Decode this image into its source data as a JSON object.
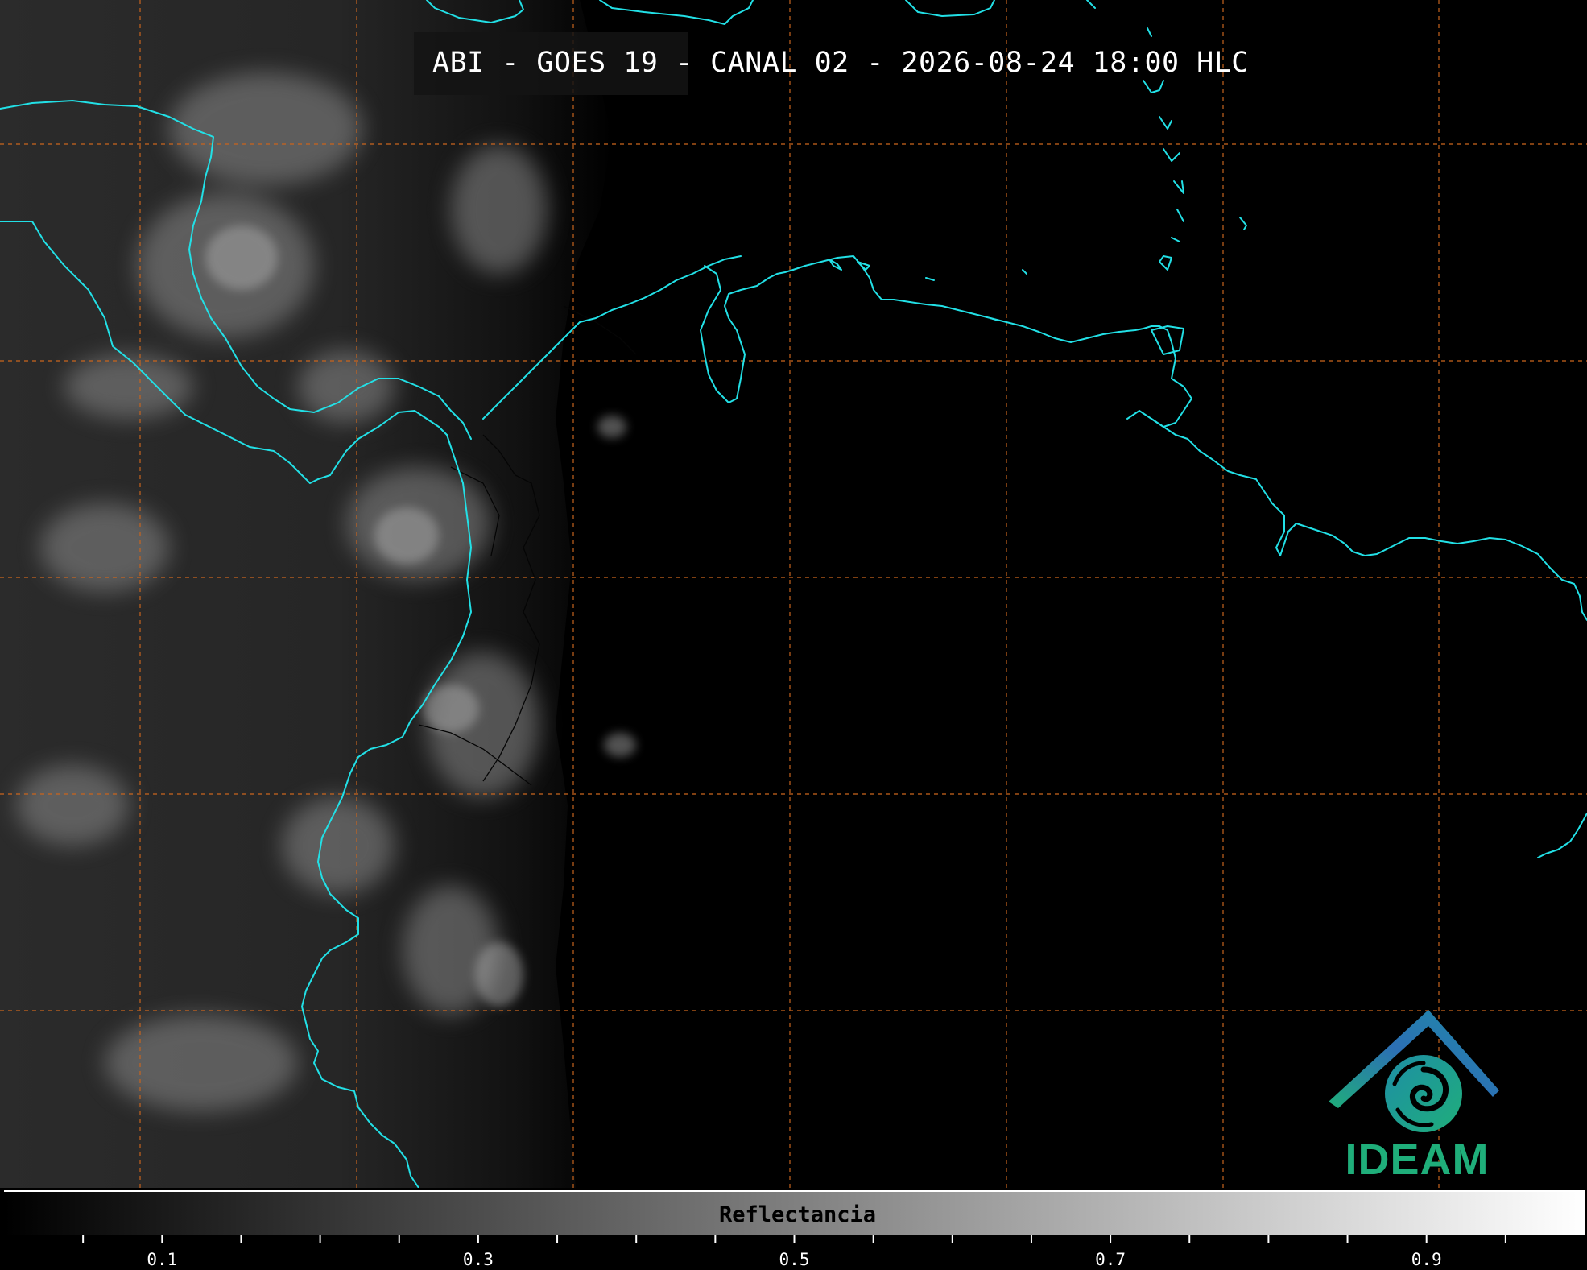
{
  "header": {
    "title": "ABI - GOES 19 - CANAL 02 - 2026-08-24 18:00 HLC"
  },
  "logo": {
    "text": "IDEAM",
    "roof_color": "#2c6fb5",
    "swirl_color": "#1fae7a"
  },
  "colors": {
    "background": "#000000",
    "coastline": "#22e0e6",
    "political_border": "#050505",
    "graticule": "#c8651e",
    "title_text": "#ffffff"
  },
  "colorbar": {
    "label": "Reflectancia",
    "range": [
      0.0,
      1.0
    ],
    "labeled_ticks": [
      "0.1",
      "0.3",
      "0.5",
      "0.7",
      "0.9"
    ],
    "minor_tick_step": 0.05,
    "ramp_start": "#000000",
    "ramp_end": "#ffffff"
  },
  "map": {
    "product": "Reflectance (visible channel)",
    "daylit_region": "western third",
    "night_region": "eastern two thirds"
  }
}
